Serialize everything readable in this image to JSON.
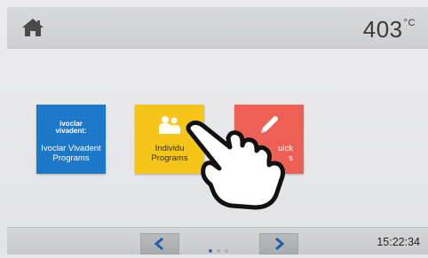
{
  "header": {
    "home_icon": "home-icon",
    "temperature": "403",
    "temperature_unit": "°C"
  },
  "programs": [
    {
      "label_line1": "Ivoclar Vivadent",
      "label_line2": "Programs",
      "logo_line1": "ivoclar",
      "logo_line2": "vivadent:",
      "color": "#1c78c8",
      "icon": "ivoclar-vivadent-logo"
    },
    {
      "label_line1": "Individu",
      "label_line2": "Programs",
      "color": "#f5c518",
      "icon": "people-icon"
    },
    {
      "label_line1": "uick",
      "label_line2": "s",
      "color": "#ee6055",
      "icon": "pen-icon"
    }
  ],
  "footer": {
    "prev_icon": "chevron-left-icon",
    "next_icon": "chevron-right-icon",
    "page_count": 3,
    "current_page": 1,
    "time": "15:22:34"
  },
  "colors": {
    "nav_chevron": "#1f5fa8",
    "page_dot_active": "#2f6fae"
  }
}
